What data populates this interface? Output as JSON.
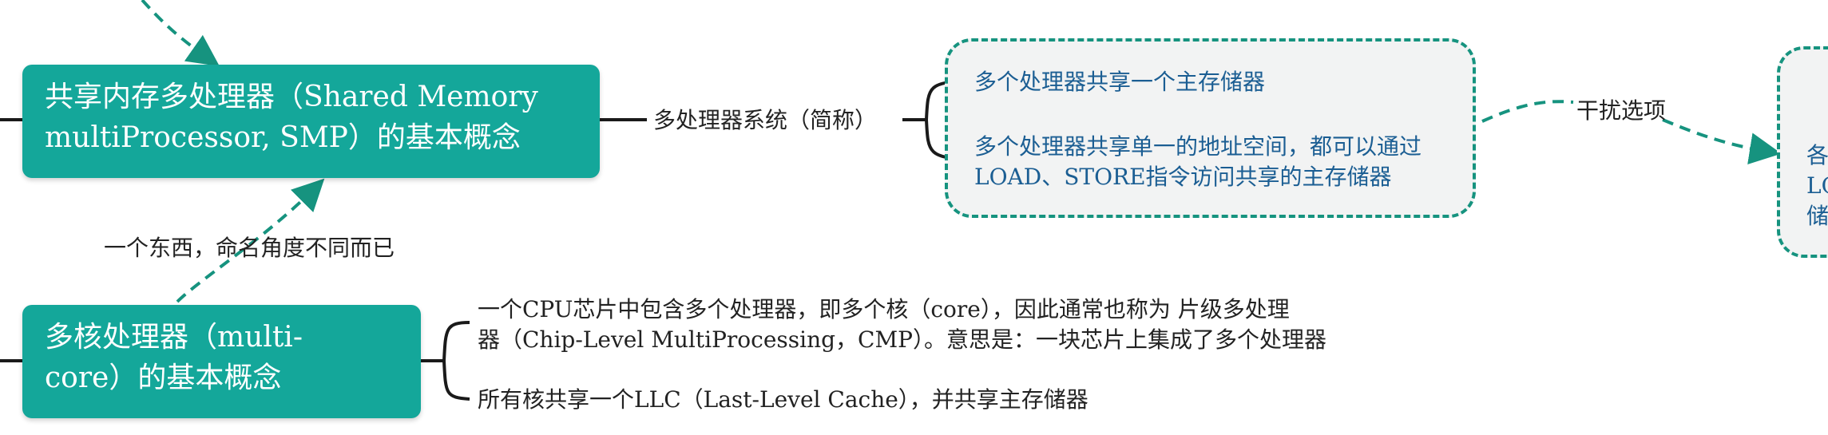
{
  "nodes": {
    "smp_title_line1": "共享内存多处理器（Shared Memory",
    "smp_title_line2": "multiProcessor, SMP）的基本概念",
    "multicore_title_line1": "多核处理器（multi-",
    "multicore_title_line2": "core）的基本概念"
  },
  "labels": {
    "smp_alias": "多处理器系统（简称）",
    "same_thing": "一个东西，命名角度不同而已",
    "interference": "干扰选项"
  },
  "smp_points": {
    "point1": "多个处理器共享一个主存储器",
    "point2_line1": "多个处理器共享单一的地址空间，都可以通过",
    "point2_line2": "LOAD、STORE指令访问共享的主存储器"
  },
  "multicore_points": {
    "point1_line1": "一个CPU芯片中包含多个处理器，即多个核（core），因此通常也称为 片级多处理",
    "point1_line2": "器（Chip-Level MultiProcessing，CMP）。意思是：一块芯片上集成了多个处理器",
    "point2": "所有核共享一个LLC（Last-Level Cache），并共享主存储器"
  },
  "right_fragment": {
    "line1": "各",
    "line2": "LC",
    "line3": "储"
  },
  "colors": {
    "node_fill": "#14a79a",
    "dashed_link": "#16937f",
    "note_text": "#1b5e93",
    "note_fill": "#f2f3f3"
  }
}
